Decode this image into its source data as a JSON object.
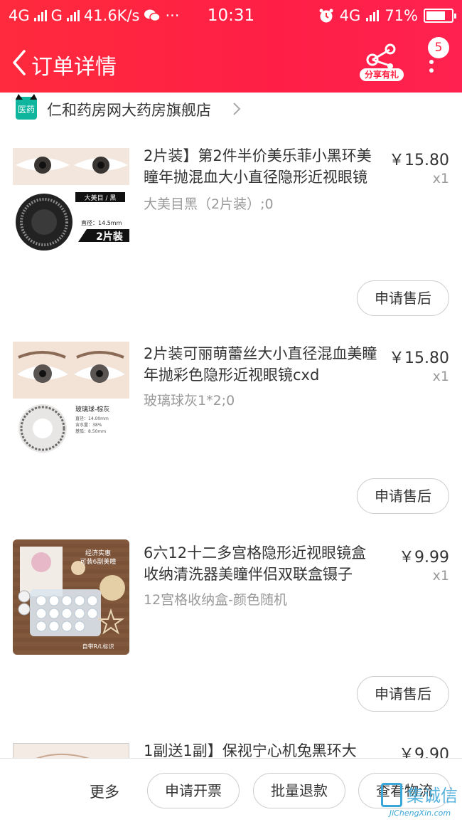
{
  "status_bar": {
    "network1": "4G",
    "network2": "G",
    "speed": "41.6K/s",
    "dots": "···",
    "time": "10:31",
    "network3": "4G",
    "battery": "71%"
  },
  "nav": {
    "title": "订单详情",
    "share_label": "分享有礼",
    "more_badge": "5"
  },
  "shop": {
    "logo_text": "医药",
    "name": "仁和药房网大药房旗舰店"
  },
  "items": [
    {
      "title": "2片装】第2件半价美乐菲小黑环美瞳年抛混血大小直径隐形近视眼镜",
      "price": "￥15.80",
      "qty": "x1",
      "spec": "大美目黑（2片装）;0",
      "after_sale": "申请售后",
      "thumb": {
        "badge": "大美目 / 黑",
        "diameter": "直径：14.5mm",
        "pack": "2片装"
      }
    },
    {
      "title": "2片装可丽萌蕾丝大小直径混血美瞳年抛彩色隐形近视眼镜cxd",
      "price": "￥15.80",
      "qty": "x1",
      "spec": "玻璃球灰1*2;0",
      "after_sale": "申请售后",
      "thumb": {
        "badge": "玻璃球-棕灰",
        "line1": "直径：14.00mm",
        "line2": "含水量：38%",
        "line3": "基弧：8.50mm"
      }
    },
    {
      "title": "6六12十二多宫格隐形近视眼镜盒收纳清洗器美瞳伴侣双联盒镊子",
      "price": "￥9.99",
      "qty": "x1",
      "spec": "12宫格收纳盒-颜色随机",
      "after_sale": "申请售后",
      "thumb": {
        "line1": "经济实惠",
        "line2": "可装6副美瞳",
        "foot": "自带R/L标识"
      }
    },
    {
      "title": "1副送1副】保视宁心机兔黑环大",
      "price": "￥9.90"
    }
  ],
  "bottom": {
    "more": "更多",
    "invoice": "申请开票",
    "batch_refund": "批量退款",
    "logistics": "查看物流"
  },
  "watermark": {
    "main": "集诚信",
    "sub": "JiChengXin.com"
  }
}
